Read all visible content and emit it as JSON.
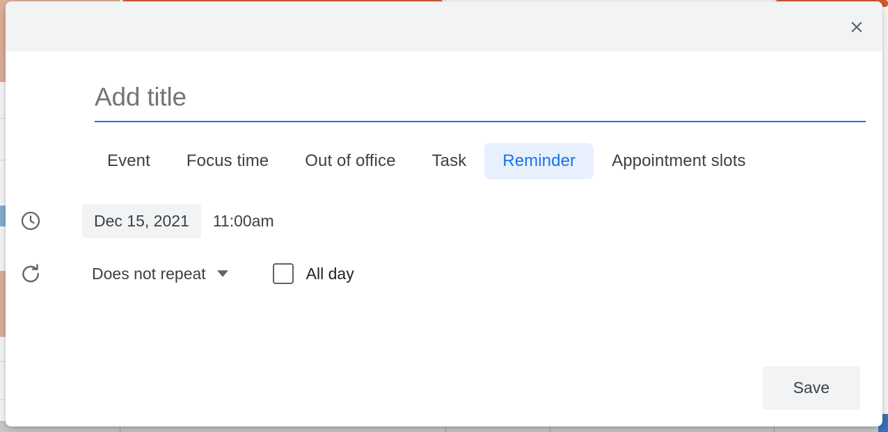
{
  "dialog": {
    "close_icon": "close-icon",
    "title_input": {
      "value": "",
      "placeholder": "Add title"
    },
    "tabs": [
      {
        "label": "Event",
        "selected": false
      },
      {
        "label": "Focus time",
        "selected": false
      },
      {
        "label": "Out of office",
        "selected": false
      },
      {
        "label": "Task",
        "selected": false
      },
      {
        "label": "Reminder",
        "selected": true
      },
      {
        "label": "Appointment slots",
        "selected": false
      }
    ],
    "datetime_row": {
      "icon": "clock-icon",
      "date": "Dec 15, 2021",
      "time": "11:00am"
    },
    "repeat_row": {
      "icon": "repeat-icon",
      "repeat_value": "Does not repeat",
      "dropdown_icon": "chevron-down-icon",
      "all_day_label": "All day",
      "all_day_checked": false
    },
    "footer": {
      "save_label": "Save"
    }
  },
  "colors": {
    "accent": "#1a73e8",
    "tab_selected_bg": "#e8f0fe",
    "header_bg": "#f1f3f4",
    "chip_bg": "#f1f3f4",
    "text_primary": "#3c4043",
    "text_placeholder": "#70757a",
    "calendar_event": "#d85b33"
  }
}
